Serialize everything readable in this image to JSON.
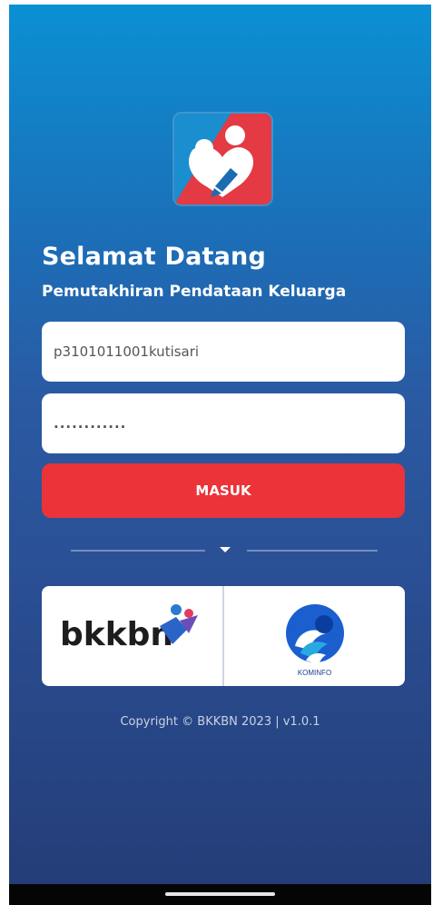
{
  "app": {
    "title": "Selamat Datang",
    "subtitle": "Pemutakhiran Pendataan Keluarga"
  },
  "form": {
    "username_value": "p3101011001kutisari",
    "password_value": "............",
    "submit_label": "MASUK"
  },
  "partners": {
    "bkkbn_logo_text": "bkkbn",
    "kominfo_label": "KOMINFO"
  },
  "footer": {
    "copyright": "Copyright © BKKBN 2023 | v1.0.1"
  },
  "colors": {
    "accent": "#eb3339",
    "gradient_top": "#0b90d4",
    "gradient_bottom": "#243d78"
  },
  "icons": {
    "app_logo": "heart-pen-logo",
    "divider_caret": "caret-down-icon"
  }
}
